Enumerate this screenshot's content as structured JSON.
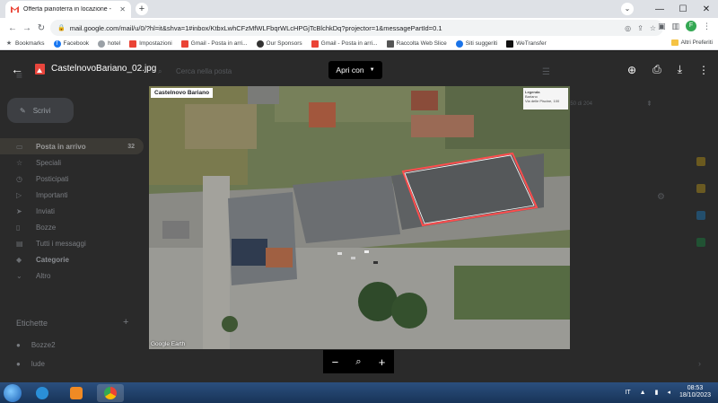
{
  "browser": {
    "tab_title": "Offerta pianoterra in locazione -",
    "url": "mail.google.com/mail/u/0/?hl=it&shva=1#inbox/KtbxLwhCFzMfWLFbqrWLcHPGjTcBlchkDq?projector=1&messagePartId=0.1",
    "profile_initial": "F",
    "bookmarks": [
      {
        "label": "Bookmarks"
      },
      {
        "label": "Facebook"
      },
      {
        "label": "hotel"
      },
      {
        "label": "Impostazioni"
      },
      {
        "label": "Gmail - Posta in arri..."
      },
      {
        "label": "Our Sponsors"
      },
      {
        "label": "Gmail - Posta in arri..."
      },
      {
        "label": "Raccolta Web Slice"
      },
      {
        "label": "Siti suggeriti"
      },
      {
        "label": "WeTransfer"
      }
    ],
    "other_bookmarks": "Altri Preferiti"
  },
  "gmail": {
    "compose": "Scrivi",
    "search_placeholder": "Cerca nella posta",
    "nav": [
      {
        "label": "Posta in arrivo",
        "count": "32"
      },
      {
        "label": "Speciali",
        "count": ""
      },
      {
        "label": "Posticipati",
        "count": ""
      },
      {
        "label": "Importanti",
        "count": ""
      },
      {
        "label": "Inviati",
        "count": ""
      },
      {
        "label": "Bozze",
        "count": ""
      },
      {
        "label": "Tutti i messaggi",
        "count": ""
      },
      {
        "label": "Categorie",
        "count": ""
      },
      {
        "label": "Altro",
        "count": ""
      }
    ],
    "labels_title": "Etichette",
    "labels": [
      "Bozze2",
      "lude"
    ],
    "range_text": "1-50 di 204"
  },
  "viewer": {
    "filename": "CastelnovoBariano_02.jpg",
    "open_with": "Apri con",
    "place_label": "Castelnovo Bariano",
    "legend_title": "Legenda",
    "legend_items": [
      "Bariano",
      "Via delle Piscine, 100"
    ],
    "watermark": "Google Earth"
  },
  "taskbar": {
    "lang": "IT",
    "time": "08:53",
    "date": "18/10/2023"
  }
}
